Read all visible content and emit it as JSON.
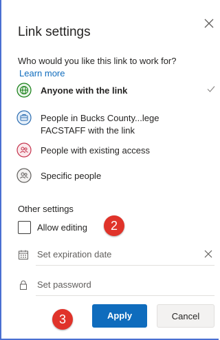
{
  "dialog": {
    "title": "Link settings",
    "question": "Who would you like this link to work for?",
    "learn_more": "Learn more"
  },
  "share_options": [
    {
      "label": "Anyone with the link",
      "icon": "globe-icon",
      "selected": true
    },
    {
      "label": "People in Bucks County...lege",
      "label_line2": "FACSTAFF with the link",
      "icon": "organization-icon",
      "selected": false
    },
    {
      "label": "People with existing access",
      "icon": "people-icon",
      "selected": false
    },
    {
      "label": "Specific people",
      "icon": "people-icon",
      "selected": false
    }
  ],
  "other_settings": {
    "title": "Other settings",
    "allow_editing_label": "Allow editing",
    "allow_editing_checked": false,
    "expiration_placeholder": "Set expiration date",
    "password_placeholder": "Set password"
  },
  "buttons": {
    "apply": "Apply",
    "cancel": "Cancel"
  },
  "annotations": {
    "step_2": "2",
    "step_3": "3"
  },
  "colors": {
    "accent": "#0f6cbd",
    "globe_green": "#107c10",
    "org_blue": "#2b6cb0",
    "existing_red": "#c4314b",
    "specific_gray": "#605e5c",
    "badge_red": "#e0332a",
    "frame_blue": "#4a6fd1"
  }
}
